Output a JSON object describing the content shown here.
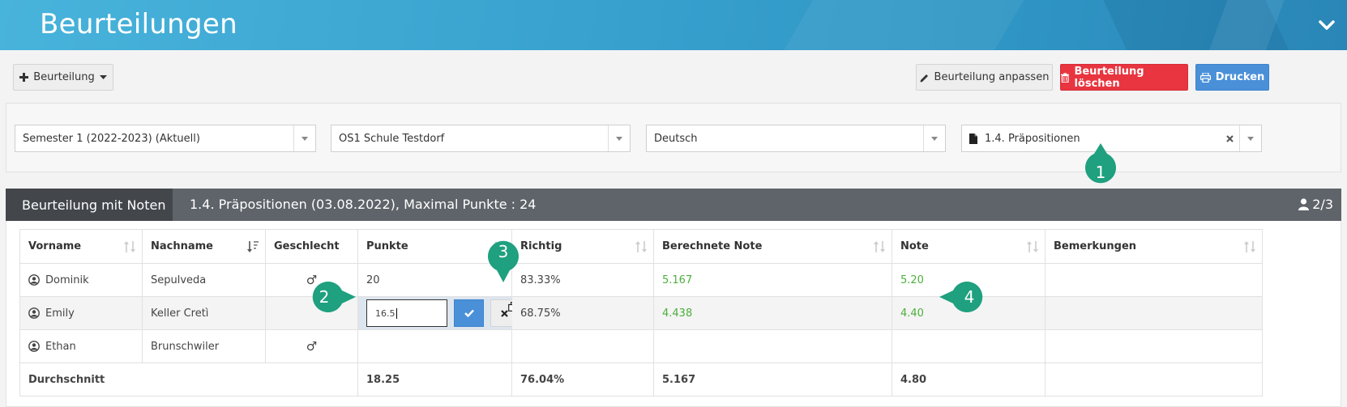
{
  "header": {
    "title": "Beurteilungen"
  },
  "toolbar": {
    "add_label": "Beurteilung",
    "edit_label": "Beurteilung anpassen",
    "delete_label": "Beurteilung löschen",
    "print_label": "Drucken"
  },
  "filters": {
    "semester": "Semester 1 (2022-2023) (Aktuell)",
    "school": "OS1 Schule Testdorf",
    "subject": "Deutsch",
    "assessment": "1.4. Präpositionen"
  },
  "section": {
    "tab_label": "Beurteilung mit Noten",
    "title": "1.4. Präpositionen (03.08.2022), Maximal Punkte : 24",
    "count": "2/3"
  },
  "table": {
    "columns": [
      "Vorname",
      "Nachname",
      "Geschlecht",
      "Punkte",
      "Richtig",
      "Berechnete Note",
      "Note",
      "Bemerkungen"
    ],
    "rows": [
      {
        "vorname": "Dominik",
        "nachname": "Sepulveda",
        "geschlecht": "♂",
        "punkte": "20",
        "richtig": "83.33%",
        "berechnete_note": "5.167",
        "note": "5.20",
        "bemerkungen": ""
      },
      {
        "vorname": "Emily",
        "nachname": "Keller Cretì",
        "geschlecht": "",
        "punkte": "16.5",
        "richtig": "68.75%",
        "berechnete_note": "4.438",
        "note": "4.40",
        "bemerkungen": ""
      },
      {
        "vorname": "Ethan",
        "nachname": "Brunschwiler",
        "geschlecht": "♂",
        "punkte": "",
        "richtig": "",
        "berechnete_note": "",
        "note": "",
        "bemerkungen": ""
      }
    ],
    "footer": {
      "label": "Durchschnitt",
      "punkte": "18.25",
      "richtig": "76.04%",
      "berechnete_note": "5.167",
      "note": "4.80"
    }
  },
  "callouts": [
    "1",
    "2",
    "3",
    "4"
  ],
  "colors": {
    "header": "#3aa3cf",
    "accent_blue": "#4a90d9",
    "danger_red": "#e8353f",
    "callout_green": "#1fa07f",
    "grade_green": "#4caf3c"
  },
  "icons": [
    "chevron-down-icon",
    "plus-icon",
    "caret-down-icon",
    "pencil-icon",
    "trash-icon",
    "print-icon",
    "file-icon",
    "clear-icon",
    "user-icon",
    "sort-icon",
    "person-circle-icon",
    "male-icon",
    "check-icon",
    "cancel-icon",
    "copy-icon"
  ]
}
